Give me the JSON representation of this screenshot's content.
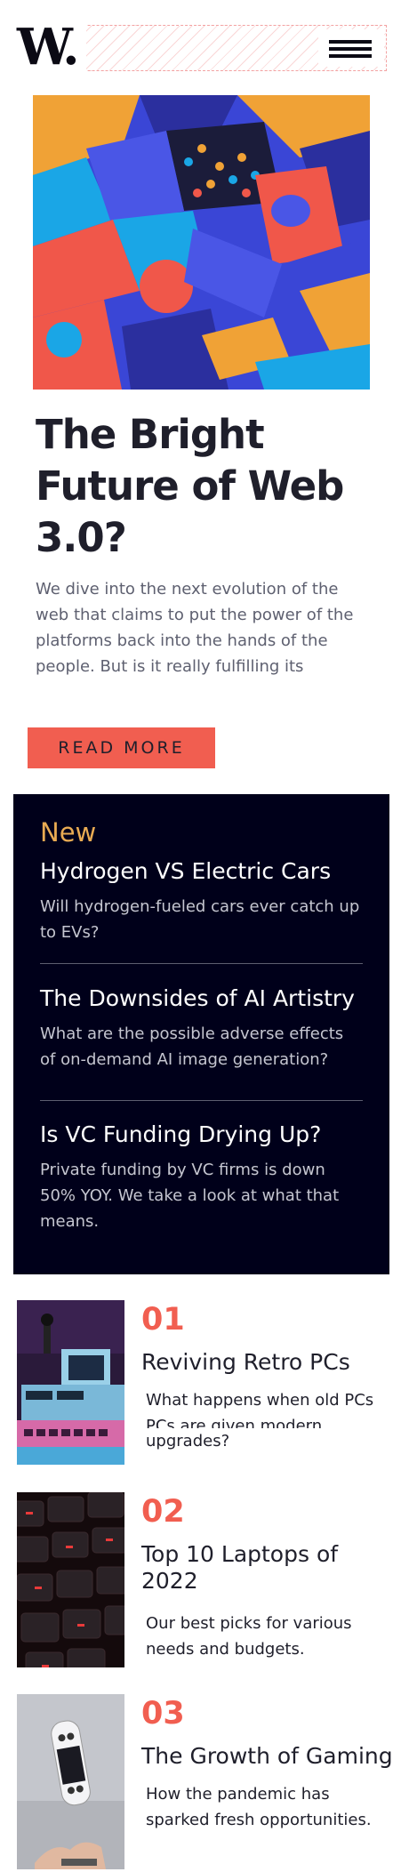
{
  "header": {
    "logo_text": "W.",
    "menu_icon": "hamburger-menu-icon"
  },
  "hero": {
    "title": "The Bright Future of Web 3.0?",
    "description": "We dive into the next evolution of the web that claims to put the power of the platforms back into the hands of the people. But is it really fulfilling its promise?",
    "button_label": "READ MORE"
  },
  "new_section": {
    "heading": "New",
    "items": [
      {
        "title": "Hydrogen VS Electric Cars",
        "description": "Will hydrogen-fueled cars ever catch up to EVs?"
      },
      {
        "title": "The Downsides of AI Artistry",
        "description": "What are the possible adverse effects of on-demand AI image generation?"
      },
      {
        "title": "Is VC Funding Drying Up?",
        "description": "Private funding by VC firms is down 50% YOY. We take a look at what that means."
      }
    ]
  },
  "articles": [
    {
      "number": "01",
      "title": "Reviving Retro PCs",
      "description": "What happens when old PCs are given modern upgrades?"
    },
    {
      "number": "02",
      "title": "Top 10 Laptops of 2022",
      "description": "Our best picks for various needs and budgets."
    },
    {
      "number": "03",
      "title": "The Growth of Gaming",
      "description": "How the pandemic has sparked fresh opportunities."
    }
  ],
  "colors": {
    "accent": "#f15e50",
    "highlight": "#e9ab53",
    "dark_panel": "#00001a",
    "text": "#1f1f2b"
  }
}
